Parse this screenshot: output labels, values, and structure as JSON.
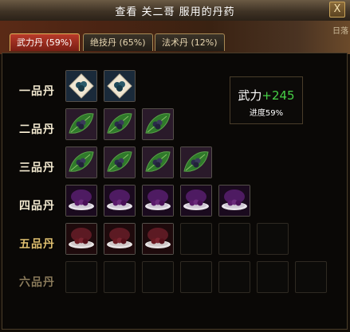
{
  "window": {
    "title": "查看  关二哥  服用的丹药",
    "close_glyph": "X",
    "scene_text": "日落"
  },
  "tabs": [
    {
      "label": "武力丹 (59%)",
      "active": true
    },
    {
      "label": "绝技丹 (65%)",
      "active": false
    },
    {
      "label": "法术丹 (12%)",
      "active": false
    }
  ],
  "grades": [
    {
      "label": "一品丹",
      "filled": 2,
      "item": "white-pill-icon"
    },
    {
      "label": "二品丹",
      "filled": 3,
      "item": "green-leaf-pill-icon"
    },
    {
      "label": "三品丹",
      "filled": 4,
      "item": "green-leaf-pill-icon"
    },
    {
      "label": "四品丹",
      "filled": 5,
      "item": "purple-bowl-pill-icon"
    },
    {
      "label": "五品丹",
      "filled": 3,
      "item": "red-bowl-pill-icon"
    },
    {
      "label": "六品丹",
      "filled": 0,
      "item": ""
    }
  ],
  "slot_count_per_row": [
    2,
    3,
    4,
    5,
    6,
    7
  ],
  "stat": {
    "name": "武力",
    "bonus": "+245",
    "progress_label": "进度59%"
  },
  "colors": {
    "active_tab": "#b83a2a",
    "bonus_green": "#46d046",
    "label_gold": "#e0c070"
  }
}
